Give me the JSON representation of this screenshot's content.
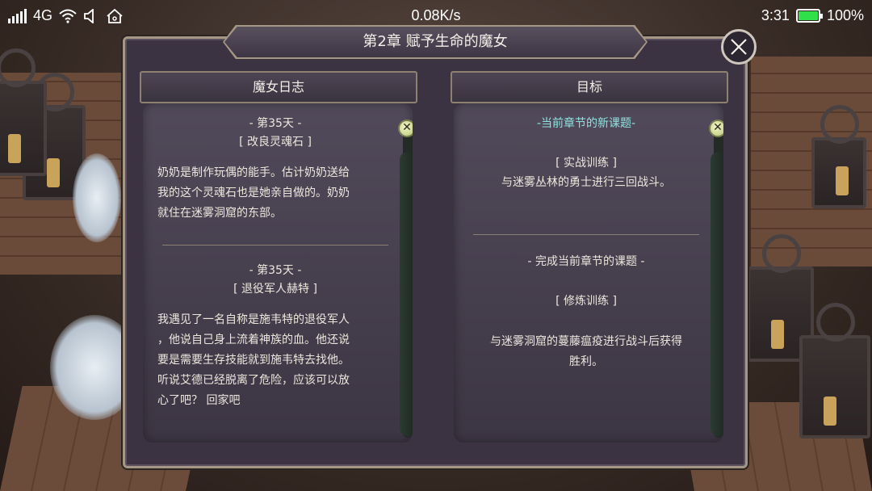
{
  "status_bar": {
    "network": "4G",
    "speed": "0.08K/s",
    "time": "3:31",
    "battery": "100%",
    "battery_color": "#2fe04a"
  },
  "dialog": {
    "title": "第2章  赋予生命的魔女",
    "close_icon": "close-icon"
  },
  "journal": {
    "header": "魔女日志",
    "entries": [
      {
        "day": "- 第35天 -",
        "tag": "[ 改良灵魂石 ]",
        "lines": [
          "奶奶是制作玩偶的能手。估计奶奶送给",
          "我的这个灵魂石也是她亲自做的。奶奶",
          "就住在迷雾洞窟的东部。"
        ]
      },
      {
        "day": "- 第35天 -",
        "tag": "[ 退役军人赫特 ]",
        "lines": [
          "我遇见了一名自称是施韦特的退役军人",
          "，他说自己身上流着神族的血。他还说",
          "要是需要生存技能就到施韦特去找他。",
          "听说艾德已经脱离了危险，应该可以放",
          "心了吧？ 回家吧"
        ]
      }
    ]
  },
  "objectives": {
    "header": "目标",
    "sections": [
      {
        "heading": "-当前章节的新课题-",
        "heading_color": "#8fe3e0",
        "tag": "[ 实战训练 ]",
        "text": "与迷雾丛林的勇士进行三回战斗。"
      },
      {
        "heading": "- 完成当前章节的课题 -",
        "tag": "[ 修炼训练 ]",
        "lines": [
          "与迷雾洞窟的蔓藤瘟疫进行战斗后获得",
          "胜利。"
        ]
      }
    ]
  }
}
